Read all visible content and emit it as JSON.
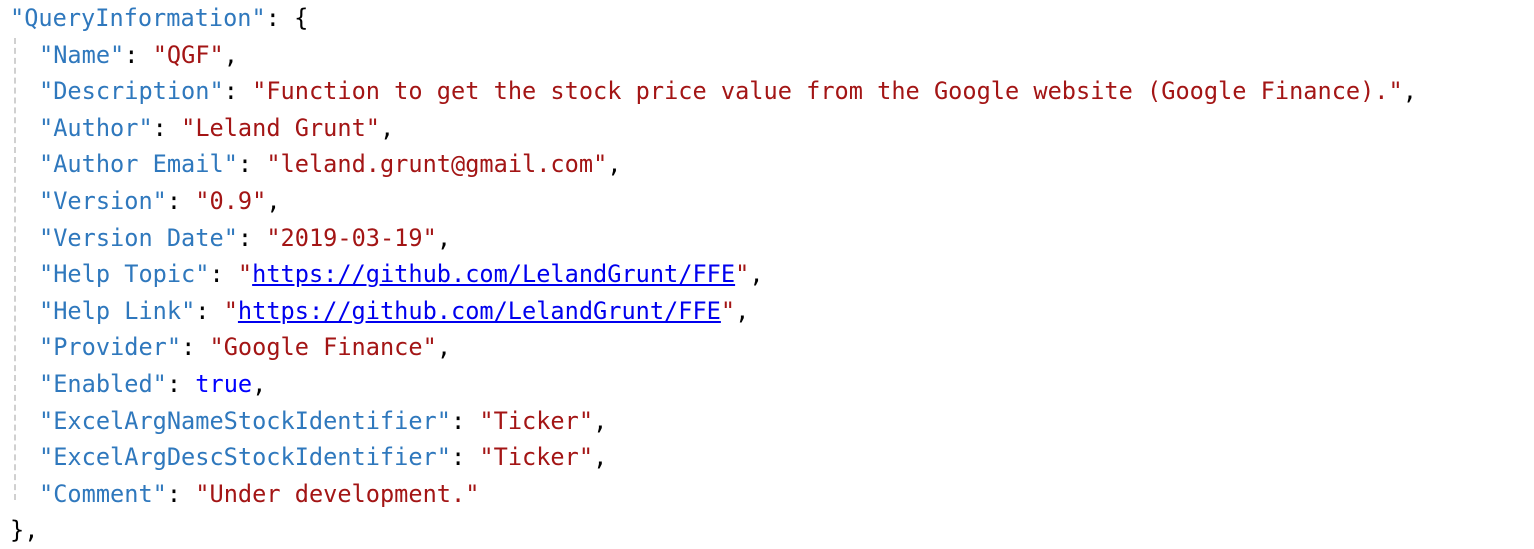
{
  "root_key": "QueryInformation",
  "entries": [
    {
      "key": "Name",
      "value": "QGF"
    },
    {
      "key": "Description",
      "value": "Function to get the stock price value from the Google website (Google Finance)."
    },
    {
      "key": "Author",
      "value": "Leland Grunt"
    },
    {
      "key": "Author Email",
      "value": "leland.grunt@gmail.com"
    },
    {
      "key": "Version",
      "value": "0.9"
    },
    {
      "key": "Version Date",
      "value": "2019-03-19"
    },
    {
      "key": "Help Topic",
      "value": "https://github.com/LelandGrunt/FFE"
    },
    {
      "key": "Help Link",
      "value": "https://github.com/LelandGrunt/FFE"
    },
    {
      "key": "Provider",
      "value": "Google Finance"
    },
    {
      "key": "Enabled",
      "value": "true"
    },
    {
      "key": "ExcelArgNameStockIdentifier",
      "value": "Ticker"
    },
    {
      "key": "ExcelArgDescStockIdentifier",
      "value": "Ticker"
    },
    {
      "key": "Comment",
      "value": "Under development."
    }
  ],
  "colors": {
    "key": "#2f78bd",
    "string": "#a31515",
    "boolean": "#0000ff",
    "link": "#0000ee"
  }
}
